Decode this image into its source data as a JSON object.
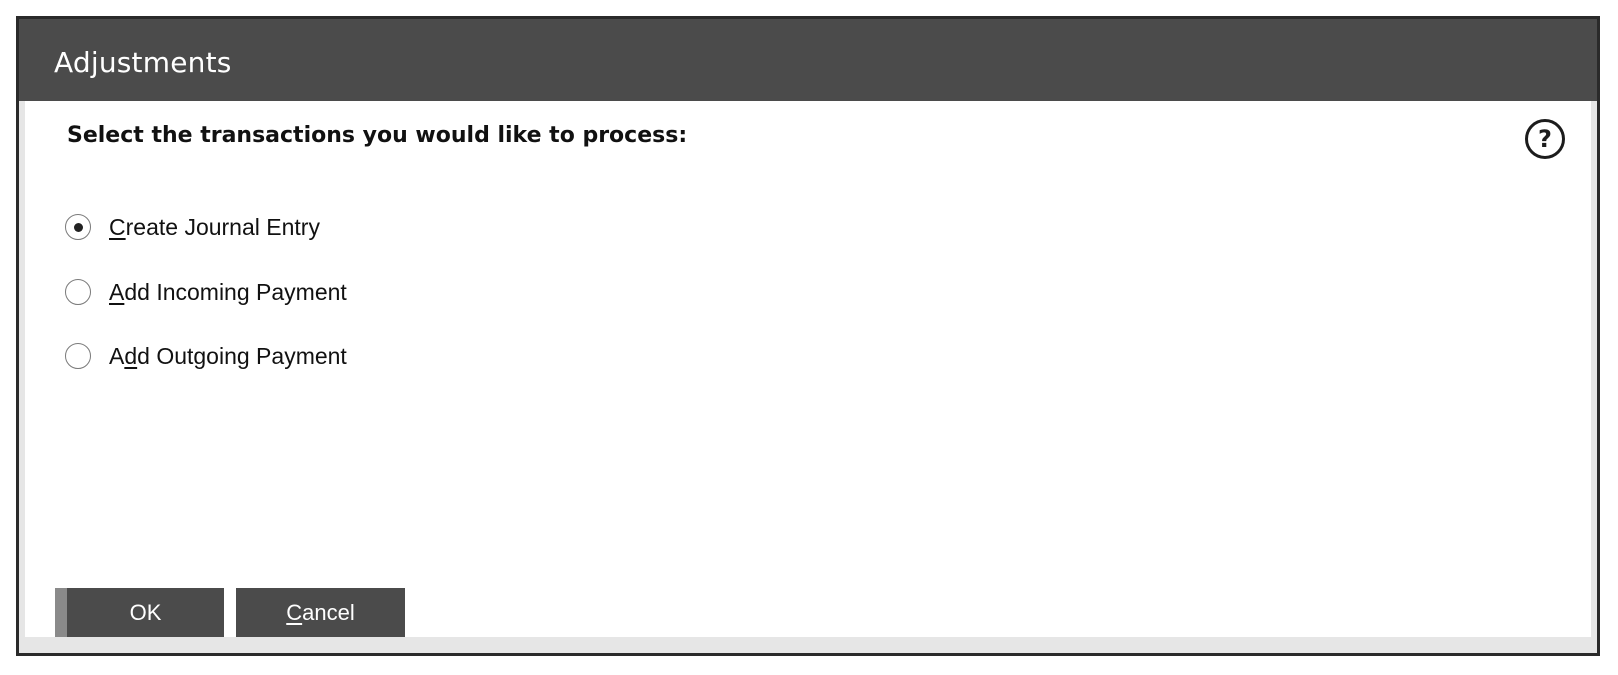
{
  "window": {
    "title": "Adjustments"
  },
  "prompt": "Select the transactions you would like to process:",
  "help_icon": "help-question-icon",
  "options": [
    {
      "label_pre": "",
      "label_key": "C",
      "label_post": "reate Journal Entry",
      "selected": true
    },
    {
      "label_pre": "",
      "label_key": "A",
      "label_post": "dd Incoming Payment",
      "selected": false
    },
    {
      "label_pre": "A",
      "label_key": "d",
      "label_post": "d Outgoing Payment",
      "selected": false
    }
  ],
  "buttons": {
    "ok_label": "OK",
    "cancel_key": "C",
    "cancel_post": "ancel"
  },
  "colors": {
    "titlebar": "#4b4b4b",
    "button": "#4b4b4b",
    "frame": "#e6e6e6"
  }
}
